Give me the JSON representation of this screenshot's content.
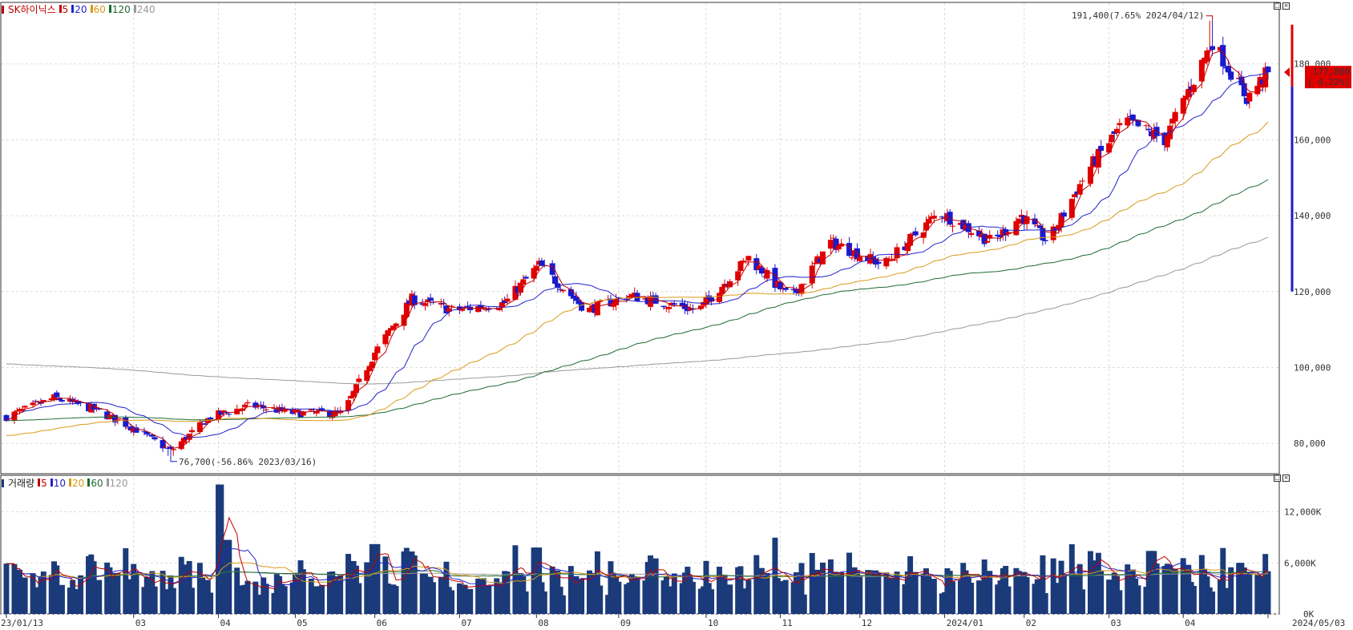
{
  "price_panel": {
    "legend": {
      "title": "SK하이닉스",
      "ma": [
        {
          "label": "5",
          "color": "#c00000"
        },
        {
          "label": "20",
          "color": "#2222cc"
        },
        {
          "label": "60",
          "color": "#d99a1a"
        },
        {
          "label": "120",
          "color": "#1e6b33"
        },
        {
          "label": "240",
          "color": "#999999"
        }
      ]
    },
    "y_ticks": [
      "180,000",
      "160,000",
      "140,000",
      "120,000",
      "100,000",
      "80,000"
    ],
    "high_annotation": "191,400(7.65% 2024/04/12)",
    "low_annotation": "76,700(-56.86% 2023/03/16)",
    "current_price": "177,800",
    "current_change": "( 4.22%)"
  },
  "volume_panel": {
    "legend": {
      "title": "거래량",
      "ma": [
        {
          "label": "5",
          "color": "#c00000"
        },
        {
          "label": "10",
          "color": "#2222cc"
        },
        {
          "label": "20",
          "color": "#d99a1a"
        },
        {
          "label": "60",
          "color": "#1e6b33"
        },
        {
          "label": "120",
          "color": "#999999"
        }
      ]
    },
    "y_ticks": [
      "12,000K",
      "6,000K",
      "0K"
    ]
  },
  "x_labels": [
    "23/01/13",
    "03",
    "04",
    "05",
    "06",
    "07",
    "08",
    "09",
    "10",
    "11",
    "12",
    "2024/01",
    "02",
    "03",
    "04",
    "2024/05/03"
  ],
  "chart_data": {
    "type": "candlestick",
    "title": "SK하이닉스",
    "x_range": [
      "2023/01/13",
      "2024/05/03"
    ],
    "price_ylim": [
      72000,
      196000
    ],
    "volume_ylim": [
      0,
      16000
    ],
    "price_anchors": [
      {
        "date": "2023/01/13",
        "close": 87000
      },
      {
        "date": "2023/01/31",
        "close": 92000
      },
      {
        "date": "2023/02/15",
        "close": 89000
      },
      {
        "date": "2023/03/02",
        "close": 84000
      },
      {
        "date": "2023/03/16",
        "close": 78000
      },
      {
        "date": "2023/03/31",
        "close": 87000
      },
      {
        "date": "2023/04/15",
        "close": 90000
      },
      {
        "date": "2023/05/01",
        "close": 88000
      },
      {
        "date": "2023/05/20",
        "close": 88000
      },
      {
        "date": "2023/06/01",
        "close": 104000
      },
      {
        "date": "2023/06/15",
        "close": 118000
      },
      {
        "date": "2023/07/01",
        "close": 115000
      },
      {
        "date": "2023/07/20",
        "close": 117000
      },
      {
        "date": "2023/08/02",
        "close": 127000
      },
      {
        "date": "2023/08/20",
        "close": 115000
      },
      {
        "date": "2023/09/05",
        "close": 119000
      },
      {
        "date": "2023/10/01",
        "close": 115000
      },
      {
        "date": "2023/10/20",
        "close": 129000
      },
      {
        "date": "2023/11/05",
        "close": 118000
      },
      {
        "date": "2023/11/20",
        "close": 133000
      },
      {
        "date": "2023/12/10",
        "close": 127000
      },
      {
        "date": "2023/12/31",
        "close": 141000
      },
      {
        "date": "2024/01/20",
        "close": 133000
      },
      {
        "date": "2024/01/31",
        "close": 140000
      },
      {
        "date": "2024/02/10",
        "close": 133000
      },
      {
        "date": "2024/02/25",
        "close": 152000
      },
      {
        "date": "2024/03/10",
        "close": 165000
      },
      {
        "date": "2024/03/25",
        "close": 160000
      },
      {
        "date": "2024/04/12",
        "close": 186000
      },
      {
        "date": "2024/04/25",
        "close": 171000
      },
      {
        "date": "2024/05/03",
        "close": 177800
      }
    ],
    "moving_average_endpoints": {
      "ma5": 176000,
      "ma20": 180500,
      "ma60": 164000,
      "ma120": 149000,
      "ma240": 132000
    },
    "high": {
      "value": 191400,
      "change_pct": 7.65,
      "date": "2024/04/12"
    },
    "low": {
      "value": 76700,
      "change_pct": -56.86,
      "date": "2023/03/16"
    },
    "last": {
      "value": 177800,
      "change_pct": 4.22
    },
    "volume_peaks_k": [
      {
        "date": "2023/04/03",
        "value": 15200
      },
      {
        "date": "2023/04/06",
        "value": 8700
      },
      {
        "date": "2023/06/01",
        "value": 8200
      },
      {
        "date": "2023/08/01",
        "value": 7800
      },
      {
        "date": "2024/03/20",
        "value": 7400
      },
      {
        "date": "2024/04/22",
        "value": 6000
      }
    ]
  }
}
